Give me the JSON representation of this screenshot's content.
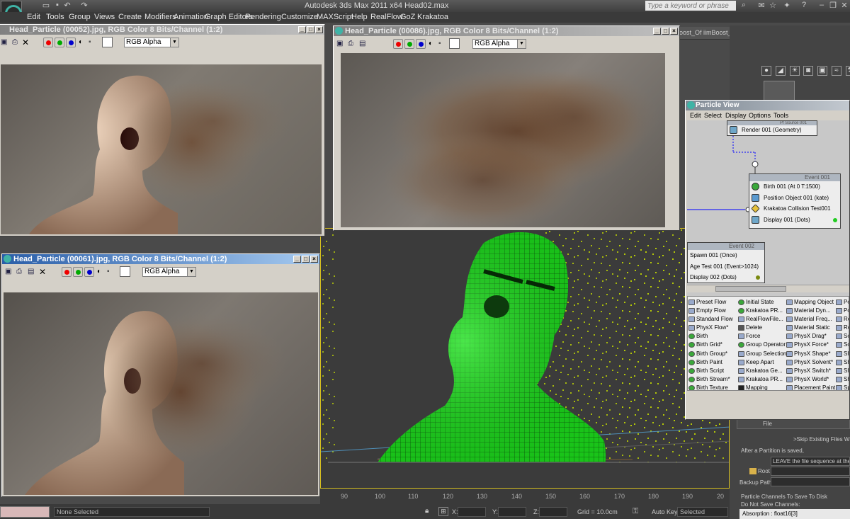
{
  "app": {
    "title": "Autodesk 3ds Max  2011 x64      Head02.max",
    "search_placeholder": "Type a keyword or phrase",
    "menu": [
      "Edit",
      "Tools",
      "Group",
      "Views",
      "Create",
      "Modifiers",
      "Animation",
      "Graph Editors",
      "Rendering",
      "Customize",
      "MAXScript",
      "Help",
      "RealFlow",
      "GoZ",
      "Krakatoa"
    ]
  },
  "frame_windows": [
    {
      "title": "Head_Particle (00052).jpg, RGB Color 8 Bits/Channel (1:2)",
      "channel": "RGB Alpha"
    },
    {
      "title": "Head_Particle (00086).jpg, RGB Color 8 Bits/Channel (1:2)",
      "channel": "RGB Alpha"
    },
    {
      "title": "Head_Particle (00061).jpg, RGB Color 8 Bits/Channel (1:2)",
      "channel": "RGB Alpha"
    }
  ],
  "behind_label": "oost_Of iimBoost_Manu",
  "particle_view": {
    "title": "Particle View",
    "menu": [
      "Edit",
      "Select",
      "Display",
      "Options",
      "Tools"
    ],
    "source_label": "Pf Source 001",
    "render_op": "Render 001 (Geometry)",
    "event1": {
      "title": "Event 001",
      "rows": [
        "Birth 001 (At 0 T:1500)",
        "Position Object 001 (kate)",
        "Krakatoa Collision Test001",
        "Display 001 (Dots)"
      ]
    },
    "event2": {
      "title": "Event 002",
      "rows": [
        "Spawn 001 (Once)",
        "Age Test 001 (Event>1024)",
        "Display 002 (Dots)"
      ]
    },
    "depot": [
      [
        "Preset Flow",
        "Empty Flow",
        "Standard Flow",
        "PhysX Flow*",
        "Birth",
        "Birth Grid*",
        "Birth Group*",
        "Birth Paint",
        "Birth Script",
        "Birth Stream*",
        "Birth Texture"
      ],
      [
        "Initial State",
        "Krakatoa PR...",
        "RealFlowFile...",
        "Delete",
        "Force",
        "Group Operator",
        "Group Selection",
        "Keep Apart",
        "Krakatoa Ge...",
        "Krakatoa PR...",
        "Mapping"
      ],
      [
        "Mapping Object",
        "Material Dyn...",
        "Material Freq...",
        "Material Static",
        "PhysX Drag*",
        "PhysX Force*",
        "PhysX Shape*",
        "PhysX Solvent*",
        "PhysX Switch*",
        "PhysX World*",
        "Placement Paint"
      ],
      [
        "Pos",
        "Pos",
        "Re",
        "Ro",
        "Sc",
        "Scr",
        "Sh",
        "Sh",
        "Sh",
        "Sh",
        "Sp"
      ]
    ]
  },
  "right_panel": {
    "file_label": "File",
    "skip_text": ">Skip Existing Files When",
    "after_partition": "After a Partition is saved,",
    "leave_text": "LEAVE the file sequence at the S",
    "root_label": "Root",
    "backup_label": "Backup Path",
    "channels_label": "Particle Channels To Save To Disk",
    "do_not_save": "Do Not Save Channels:",
    "channel_item": "Absorption  : float16[3]"
  },
  "timeline": {
    "ticks": [
      "90",
      "100",
      "110",
      "120",
      "130",
      "140",
      "150",
      "160",
      "170",
      "180",
      "190",
      "20"
    ]
  },
  "status": {
    "selection": "None Selected",
    "x_label": "X:",
    "y_label": "Y:",
    "z_label": "Z:",
    "grid": "Grid = 10.0cm",
    "autokey": "Auto Key",
    "selected": "Selected"
  },
  "colors": {
    "accent_green": "#22cc22",
    "particle_yellow": "#c8e000",
    "caption_blue": "#2a5ea8"
  }
}
